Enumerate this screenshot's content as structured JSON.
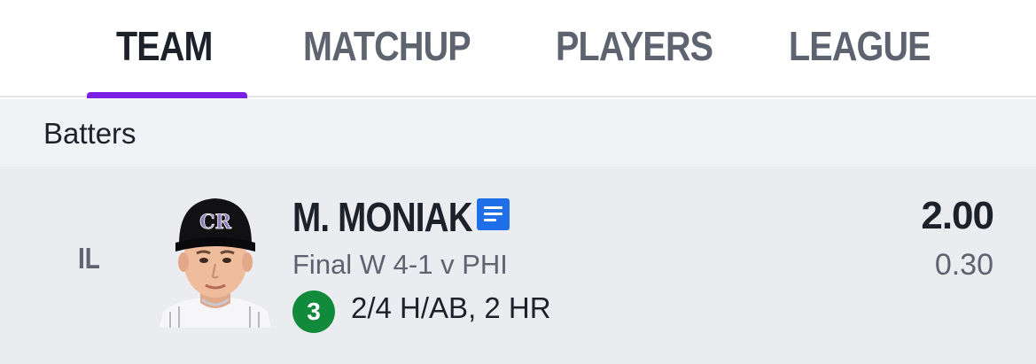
{
  "tabs": [
    {
      "label": "TEAM",
      "active": true
    },
    {
      "label": "MATCHUP",
      "active": false
    },
    {
      "label": "PLAYERS",
      "active": false
    },
    {
      "label": "LEAGUE",
      "active": false
    }
  ],
  "colors": {
    "accent": "#7b1fe6",
    "notes_icon": "#1f70e8",
    "rank_badge": "#128a3c"
  },
  "section": {
    "title": "Batters"
  },
  "player": {
    "slot": "IL",
    "name": "M. MONIAK",
    "notes_icon": "document-lines-icon",
    "game_status": "Final W 4-1 v PHI",
    "rank": "3",
    "stat_line": "2/4 H/AB, 2 HR",
    "points": "2.00",
    "projected": "0.30",
    "cap_logo": "CR"
  }
}
